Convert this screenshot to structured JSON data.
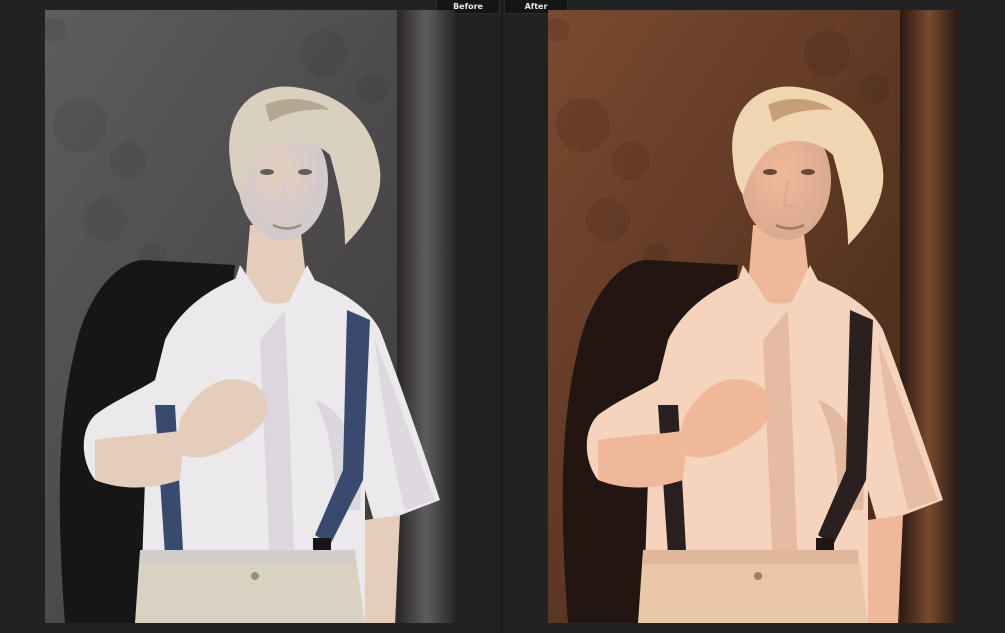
{
  "tabs": {
    "before_label": "Before",
    "after_label": "After"
  },
  "panels": {
    "before": {
      "wall": "#5f5c5f",
      "wall_dark": "#3a3739",
      "side": "#2a262a",
      "skin": "#e5cdbc",
      "hair": "#d9d0bf",
      "hair_dark": "#9b8e76",
      "shirt": "#ece9ec",
      "shirt_shadow": "#cfc9d1",
      "jacket": "#161618",
      "suspender": "#394a6e",
      "pants": "#d8d2c2"
    },
    "after": {
      "wall": "#7a4a30",
      "wall_dark": "#3f2417",
      "side": "#2a1a12",
      "skin": "#f0b89a",
      "hair": "#f0d6b0",
      "hair_dark": "#a67a52",
      "shirt": "#f6d3bd",
      "shirt_shadow": "#d9a890",
      "jacket": "#231511",
      "suspender": "#2a2020",
      "pants": "#e9c7a8"
    }
  }
}
